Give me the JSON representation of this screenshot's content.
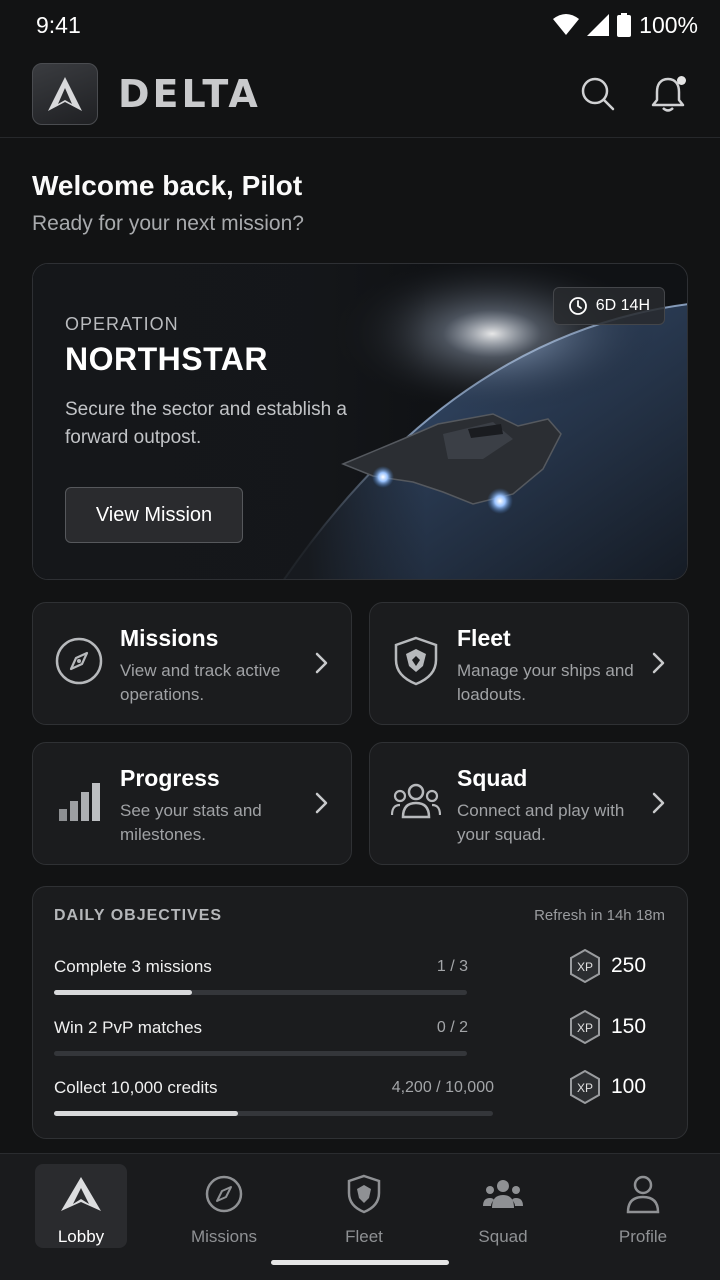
{
  "status_bar": {
    "time": "9:41",
    "battery": "100%"
  },
  "header": {
    "brand": "DELTA"
  },
  "welcome": {
    "title": "Welcome back, Pilot",
    "subtitle": "Ready for your next mission?"
  },
  "hero": {
    "eyebrow": "OPERATION",
    "title": "NORTHSTAR",
    "description": "Secure the sector and establish a forward outpost.",
    "button_label": "View Mission",
    "timer": "6D 14H"
  },
  "tiles": [
    {
      "title": "Missions",
      "description": "View and track active operations.",
      "icon": "compass-icon"
    },
    {
      "title": "Fleet",
      "description": "Manage your ships and loadouts.",
      "icon": "shield-icon"
    },
    {
      "title": "Progress",
      "description": "See your stats and milestones.",
      "icon": "bar-chart-icon"
    },
    {
      "title": "Squad",
      "description": "Connect and play with your squad.",
      "icon": "group-icon"
    }
  ],
  "objectives": {
    "heading": "DAILY OBJECTIVES",
    "refresh": "Refresh in 14h 18m",
    "items": [
      {
        "label": "Complete 3 missions",
        "count": "1 / 3",
        "progress": 0.333,
        "reward": "250"
      },
      {
        "label": "Win 2 PvP matches",
        "count": "0 / 2",
        "progress": 0.0,
        "reward": "150"
      },
      {
        "label": "Collect 10,000 credits",
        "count": "4,200 / 10,000",
        "progress": 0.42,
        "reward": "100"
      }
    ],
    "reward_badge": "XP"
  },
  "tabs": [
    {
      "label": "Lobby",
      "icon": "delta-logo-icon",
      "active": true
    },
    {
      "label": "Missions",
      "icon": "compass-icon",
      "active": false
    },
    {
      "label": "Fleet",
      "icon": "shield-icon",
      "active": false
    },
    {
      "label": "Squad",
      "icon": "group-icon",
      "active": false
    },
    {
      "label": "Profile",
      "icon": "person-icon",
      "active": false
    }
  ]
}
